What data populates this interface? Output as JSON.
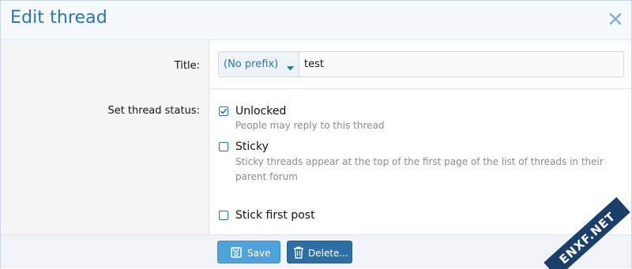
{
  "dialog": {
    "title": "Edit thread",
    "close_icon": "close-icon"
  },
  "form": {
    "title_label": "Title:",
    "prefix_value": "(No prefix)",
    "title_value": "test",
    "status_label": "Set thread status:"
  },
  "status_options": [
    {
      "label": "Unlocked",
      "hint": "People may reply to this thread",
      "checked": true
    },
    {
      "label": "Sticky",
      "hint": "Sticky threads appear at the top of the first page of the list of threads in their parent forum",
      "checked": false
    },
    {
      "label": "Stick first post",
      "hint": "",
      "checked": false
    }
  ],
  "footer": {
    "save_label": "Save",
    "delete_label": "Delete..."
  },
  "watermark": {
    "text": "ENXF.NET"
  },
  "colors": {
    "accent": "#2577b1",
    "save_button": "#4fa3dd",
    "delete_button": "#2b6fa6",
    "watermark_badge": "#1b3f6b"
  }
}
